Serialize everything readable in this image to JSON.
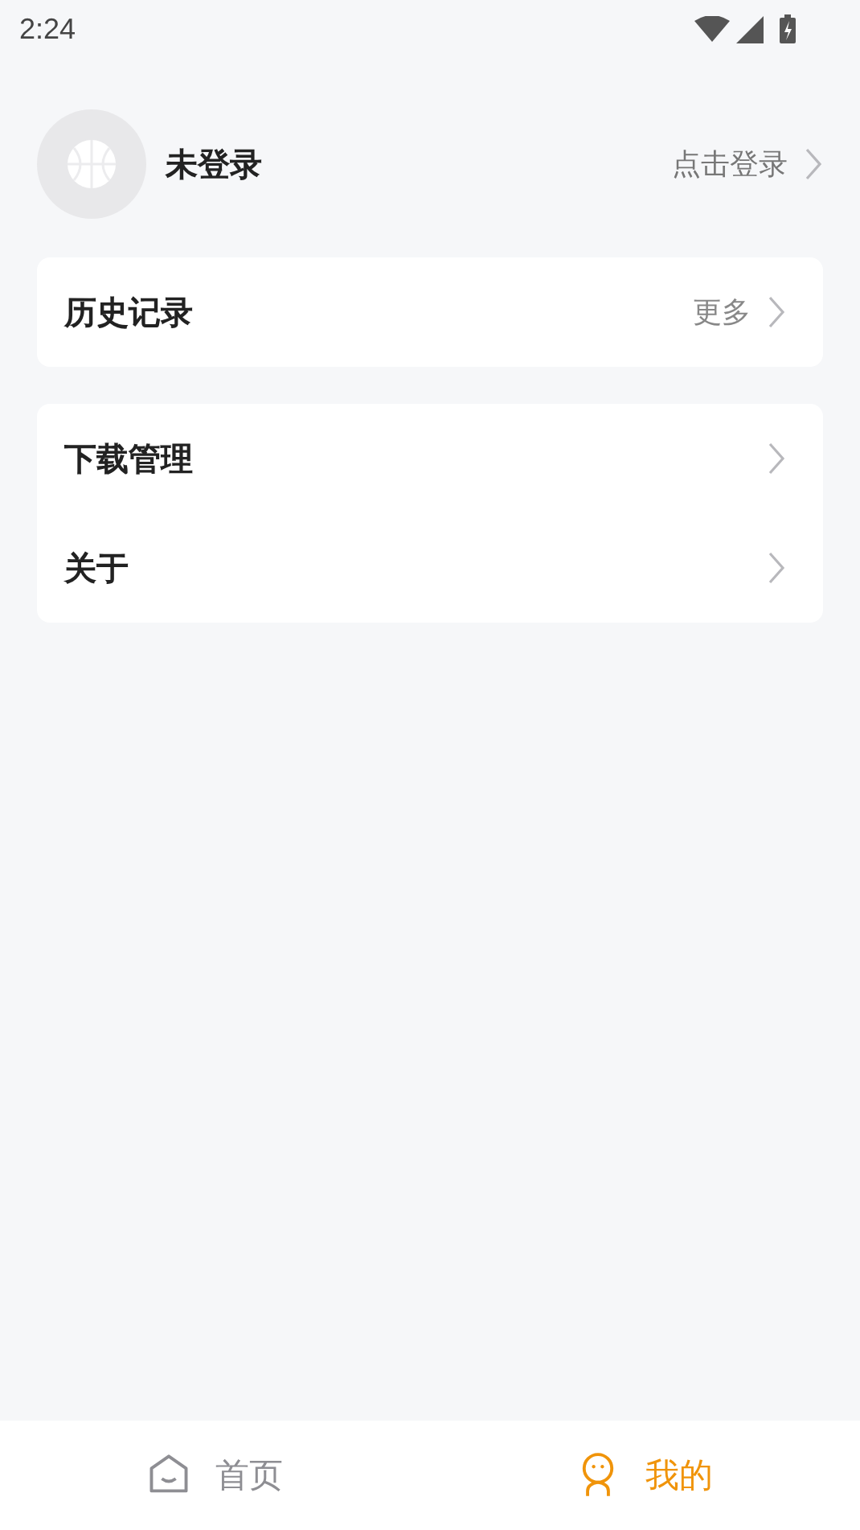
{
  "status_bar": {
    "time": "2:24"
  },
  "profile": {
    "name": "未登录",
    "action": "点击登录"
  },
  "groups": [
    {
      "items": [
        {
          "label": "历史记录",
          "trailing": "更多"
        }
      ]
    },
    {
      "items": [
        {
          "label": "下载管理"
        },
        {
          "label": "关于"
        }
      ]
    }
  ],
  "bottom_nav": [
    {
      "label": "首页",
      "kind": "home",
      "selected": false
    },
    {
      "label": "我的",
      "kind": "me",
      "selected": true
    }
  ]
}
